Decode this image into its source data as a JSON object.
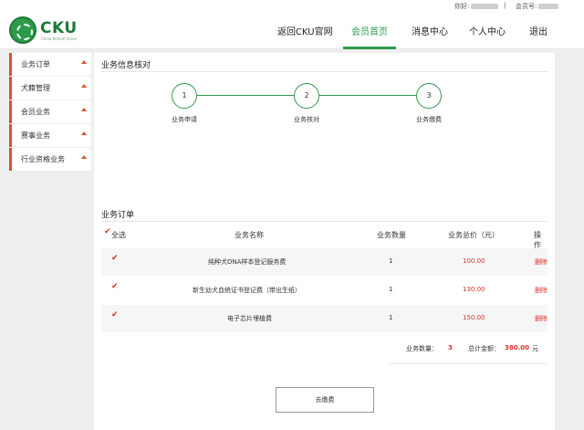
{
  "topbar": {
    "greeting": "你好:",
    "separator": "|",
    "member_no_label": "会员号:"
  },
  "logo": {
    "text": "CKU",
    "subtitle": "China Kennel Union"
  },
  "nav": [
    {
      "label": "返回CKU官网"
    },
    {
      "label": "会员首页",
      "active": true
    },
    {
      "label": "消息中心"
    },
    {
      "label": "个人中心"
    },
    {
      "label": "退出"
    }
  ],
  "sidebar": {
    "items": [
      {
        "label": "业务订单"
      },
      {
        "label": "犬籍管理"
      },
      {
        "label": "会员业务"
      },
      {
        "label": "赛事业务"
      },
      {
        "label": "行业资格业务"
      }
    ]
  },
  "verify": {
    "title": "业务信息核对",
    "steps": [
      {
        "num": "1",
        "label": "业务申请"
      },
      {
        "num": "2",
        "label": "业务核对"
      },
      {
        "num": "3",
        "label": "业务缴费"
      }
    ]
  },
  "orders": {
    "title": "业务订单",
    "headers": {
      "select_all": "全选",
      "name": "业务名称",
      "qty": "业务数量",
      "total": "业务总价（元）",
      "op": "操作"
    },
    "rows": [
      {
        "name": "纯种犬DNA样本登记服务费",
        "qty": "1",
        "price": "100.00",
        "action": "删除"
      },
      {
        "name": "新生幼犬血统证书登记费（带出生纸）",
        "qty": "1",
        "price": "130.00",
        "action": "删除"
      },
      {
        "name": "电子芯片埋植费",
        "qty": "1",
        "price": "150.00",
        "action": "删除"
      }
    ],
    "summary": {
      "qty_label": "业务数量：",
      "qty_value": "3",
      "amount_label": "总计金额：",
      "amount_value": "380.00",
      "unit": "元"
    },
    "pay_button": "去缴费"
  },
  "colors": {
    "brand_green": "#2e9a4b",
    "accent_red": "#d9302b"
  }
}
